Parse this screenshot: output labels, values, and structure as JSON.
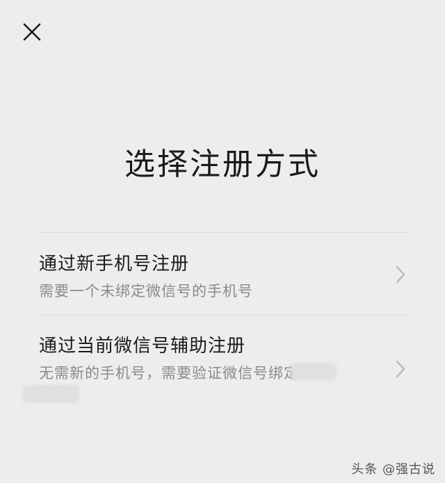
{
  "header": {
    "close_icon": "close-icon"
  },
  "page_title": "选择注册方式",
  "options": [
    {
      "title": "通过新手机号注册",
      "description": "需要一个未绑定微信号的手机号",
      "icon": "chevron-right-icon"
    },
    {
      "title": "通过当前微信号辅助注册",
      "description": "无需新的手机号，需要验证微信号绑定的手机号",
      "icon": "chevron-right-icon"
    }
  ],
  "watermark": "头条 @强古说",
  "colors": {
    "background": "#ededed",
    "title_text": "#1a1a1a",
    "secondary_text": "#8a8a8a",
    "divider": "#dcdcdc"
  }
}
